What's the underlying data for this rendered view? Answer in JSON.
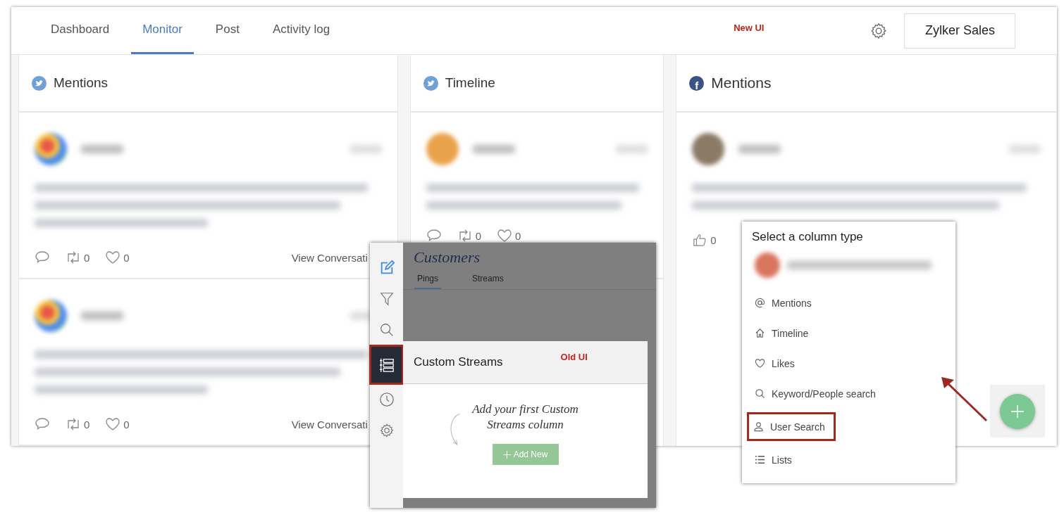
{
  "header": {
    "tabs": [
      {
        "label": "Dashboard",
        "selected": false
      },
      {
        "label": "Monitor",
        "selected": true
      },
      {
        "label": "Post",
        "selected": false
      },
      {
        "label": "Activity log",
        "selected": false
      }
    ],
    "annotation": "New UI",
    "account_button": "Zylker Sales"
  },
  "columns": [
    {
      "kind": "twitter",
      "title": "Mentions",
      "posts": [
        {
          "retweets": "0",
          "likes": "0",
          "link": "View Conversati"
        },
        {
          "retweets": "0",
          "likes": "0",
          "link": "View Conversati"
        }
      ]
    },
    {
      "kind": "twitter",
      "title": "Timeline",
      "posts": [
        {
          "retweets": "0",
          "likes": "0"
        }
      ]
    },
    {
      "kind": "facebook",
      "icon_text": "f",
      "title": "Mentions",
      "posts": [
        {
          "likes": "0"
        }
      ]
    }
  ],
  "old_ui": {
    "sidebar": [
      {
        "kind": "compose",
        "selected": false,
        "annotated": false
      },
      {
        "kind": "filter",
        "selected": false,
        "annotated": false
      },
      {
        "kind": "search",
        "selected": false,
        "annotated": false
      },
      {
        "kind": "streams",
        "selected": true,
        "annotated": true
      },
      {
        "kind": "clock",
        "selected": false,
        "annotated": false
      },
      {
        "kind": "settings",
        "selected": false,
        "annotated": false
      }
    ],
    "title": "Customers",
    "tabs": [
      {
        "label": "Pings",
        "selected": true
      },
      {
        "label": "Streams",
        "selected": false
      }
    ],
    "card_title": "Custom Streams",
    "annotation": "Old UI",
    "empty_message": "Add your first Custom Streams column",
    "add_button": "Add New"
  },
  "column_menu": {
    "title": "Select a column type",
    "items": [
      {
        "kind": "mentions",
        "label": "Mentions",
        "annotated": false
      },
      {
        "kind": "timeline",
        "label": "Timeline",
        "annotated": false
      },
      {
        "kind": "likes",
        "label": "Likes",
        "annotated": false
      },
      {
        "kind": "search",
        "label": "Keyword/People search",
        "annotated": false
      },
      {
        "kind": "user",
        "label": "User Search",
        "annotated": true
      },
      {
        "kind": "lists",
        "label": "Lists",
        "annotated": false
      }
    ]
  }
}
